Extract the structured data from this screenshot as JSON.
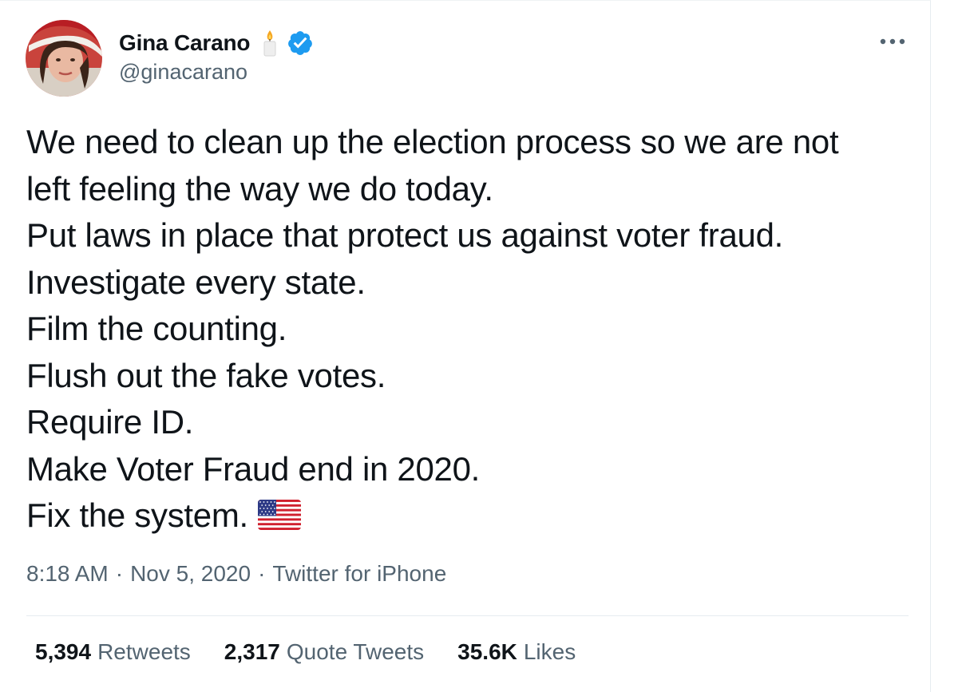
{
  "author": {
    "display_name": "Gina Carano",
    "handle": "@ginacarano",
    "candle_icon": "candle-emoji-icon",
    "verified_icon": "verified-badge-icon",
    "verified_color": "#1d9bf0"
  },
  "tweet": {
    "lines": [
      "We need to clean up the election process so we are not",
      "left feeling the way we do today.",
      "Put laws in place that protect us against voter fraud.",
      "Investigate every state.",
      "Film the counting.",
      "Flush out the fake votes.",
      "Require ID.",
      "Make Voter Fraud end in 2020.",
      "Fix the system."
    ],
    "flag_icon": "us-flag-emoji-icon"
  },
  "meta": {
    "time": "8:18 AM",
    "date": "Nov 5, 2020",
    "source": "Twitter for iPhone",
    "separator": "·"
  },
  "stats": {
    "retweets_count": "5,394",
    "retweets_label": "Retweets",
    "quotes_count": "2,317",
    "quotes_label": "Quote Tweets",
    "likes_count": "35.6K",
    "likes_label": "Likes"
  },
  "more_icon": "more-options-icon",
  "colors": {
    "text_primary": "#0f1419",
    "text_secondary": "#536471",
    "divider": "#e6ecf0"
  }
}
